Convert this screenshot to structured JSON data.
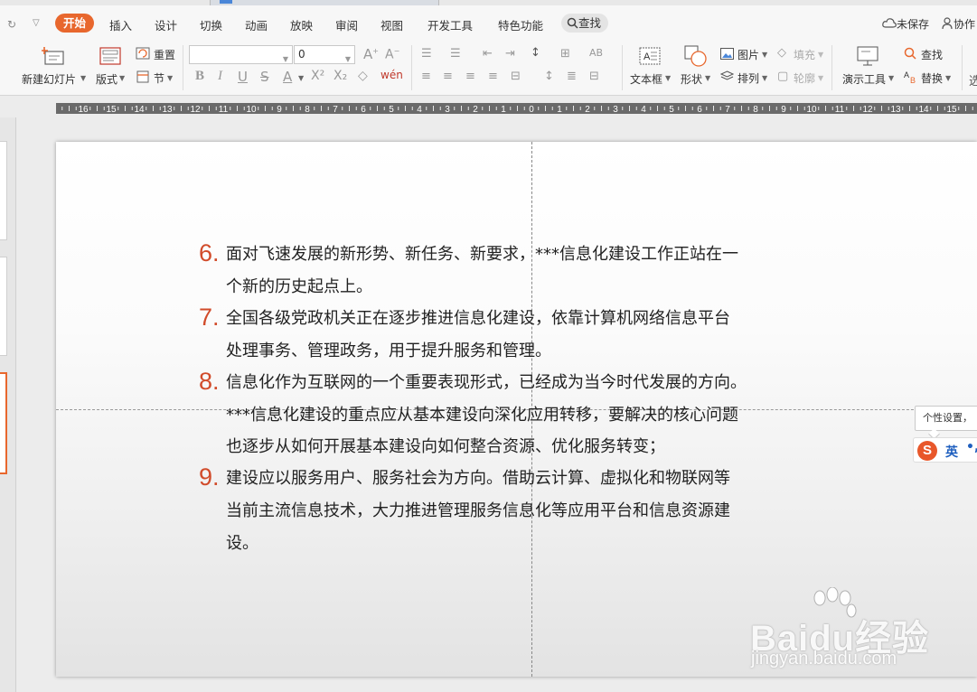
{
  "menubar": {
    "active_tab": "开始",
    "tabs": [
      "插入",
      "设计",
      "切换",
      "动画",
      "放映",
      "审阅",
      "视图",
      "开发工具",
      "特色功能"
    ],
    "search_label": "查找",
    "save_status": "未保存",
    "collab": "协作"
  },
  "ribbon": {
    "new_slide": "新建幻灯片",
    "layout": "版式",
    "reset": "重置",
    "section": "节",
    "font_name": "",
    "font_size": "0",
    "textbox": "文本框",
    "shape": "形状",
    "picture": "图片",
    "fill": "填充",
    "arrange": "排列",
    "outline": "轮廓",
    "present_tools": "演示工具",
    "find": "查找",
    "replace": "替换"
  },
  "ruler": {
    "labels": [
      "16",
      "15",
      "14",
      "13",
      "12",
      "11",
      "10",
      "9",
      "8",
      "7",
      "6",
      "5",
      "4",
      "3",
      "2",
      "1",
      "0",
      "1",
      "2",
      "3",
      "4",
      "5",
      "6",
      "7",
      "8",
      "9",
      "10",
      "11",
      "12",
      "13",
      "14",
      "15"
    ]
  },
  "slide": {
    "items": [
      {
        "number": "6.",
        "lines": [
          "面对飞速发展的新形势、新任务、新要求，***信息化建设工作正站在一",
          "个新的历史起点上。"
        ]
      },
      {
        "number": "7.",
        "lines": [
          "全国各级党政机关正在逐步推进信息化建设，依靠计算机网络信息平台",
          "处理事务、管理政务，用于提升服务和管理。"
        ]
      },
      {
        "number": "8.",
        "lines": [
          "信息化作为互联网的一个重要表现形式，已经成为当今时代发展的方向。",
          "***信息化建设的重点应从基本建设向深化应用转移，要解决的核心问题",
          "也逐步从如何开展基本建设向如何整合资源、优化服务转变；"
        ]
      },
      {
        "number": "9.",
        "lines": [
          "建设应以服务用户、服务社会为方向。借助云计算、虚拟化和物联网等",
          "当前主流信息技术，大力推进管理服务信息化等应用平台和信息资源建",
          "设。"
        ]
      }
    ]
  },
  "tooltip": {
    "text": "个性设置，"
  },
  "ime": {
    "logo": "S",
    "lang": "英",
    "punct": "•,"
  },
  "watermark": {
    "brand": "Baidu经验",
    "url": "jingyan.baidu.com"
  },
  "colors": {
    "accent": "#e8672d",
    "number": "#d14b2a"
  }
}
